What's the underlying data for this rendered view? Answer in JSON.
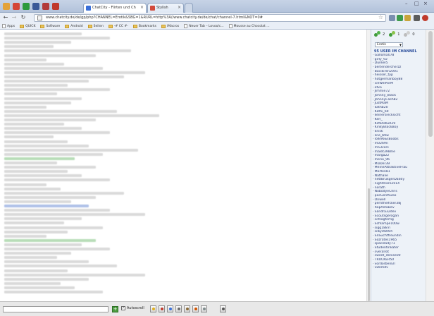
{
  "browser": {
    "tabs": [
      {
        "label": "ChatCity - Flirten und Ch",
        "favicon_color": "#3a6fd8",
        "active": true
      },
      {
        "label": "Stylish",
        "favicon_color": "#d24a3c",
        "active": false
      }
    ],
    "pinned_tab_icons": [
      {
        "name": "bookmark-icon",
        "color": "#e3a23a"
      },
      {
        "name": "gmail-icon",
        "color": "#d44638"
      },
      {
        "name": "messenger-icon",
        "color": "#2b9a3d"
      },
      {
        "name": "facebook-icon",
        "color": "#3b5998"
      },
      {
        "name": "mail-icon",
        "color": "#b23a3a"
      },
      {
        "name": "video-icon",
        "color": "#c0392b"
      }
    ],
    "url": "www.chatcity.de/de/gp/php?CHANNEL=Erotik&SBG=1&RURL=http%3A//www.chatcity.de/de/chat/channel-7.html&NOT=0#",
    "bookmarks": [
      {
        "label": "Apps",
        "type": "page"
      },
      {
        "label": "QUICK",
        "type": "folder"
      },
      {
        "label": "Software",
        "type": "folder"
      },
      {
        "label": "Android",
        "type": "folder"
      },
      {
        "label": "Seiten",
        "type": "folder"
      },
      {
        "label": "-# CC #-",
        "type": "folder"
      },
      {
        "label": "Bookmarks",
        "type": "folder"
      },
      {
        "label": "iMacros",
        "type": "folder"
      },
      {
        "label": "Neuer Tab – Lovoo/c...",
        "type": "page"
      },
      {
        "label": "Mousse au Chocolat ...",
        "type": "page"
      }
    ]
  },
  "sidebar": {
    "stats": [
      {
        "icon": "users-online-icon",
        "value": "2"
      },
      {
        "icon": "users-away-icon",
        "value": "1"
      },
      {
        "icon": "users-other-icon",
        "value": "0"
      }
    ],
    "channel_selected": "Erotik",
    "users_heading": "95 USER IM CHANNEL",
    "users": [
      "Galloma078",
      "girly_92",
      "Dunkel5",
      "bertendercherzz",
      "Bavikiren2001",
      "heisser_typ",
      "hotgermanboy88",
      "ichWillPorM",
      "otvo",
      "Jimmie72",
      "Johnny_Black",
      "JohnnyCash82",
      "JustMaM",
      "kathb20",
      "Kathi_69",
      "keinersiecksicht",
      "Kerl_",
      "KiMidsKuR29",
      "KinkyBlackBoy",
      "knisk",
      "line_b9w",
      "lolk96&sBoobs",
      "m0269n",
      "m53vers",
      "malet398me",
      "marga22",
      "merio_96",
      "Mia0er39",
      "MeineAttraktiveFrau",
      "Morten81",
      "Nathalie",
      "nettBrukgerDaddy",
      "nightmare2014",
      "norath",
      "NobodyeChris",
      "pocGent92oo",
      "Onwell",
      "pernthelfcker38j",
      "RapAstaDev",
      "Sandra32dev",
      "Scoutsgerogan",
      "schlagfertig",
      "Schlampe100w",
      "sigg1887i",
      "silkyst89ch",
      "SnSuchtfreundin",
      "Sozrates1965",
      "spacelady71",
      "Studentinkater",
      "sveralrot",
      "sweet_denise00",
      "TRUCKER50",
      "vordorbenEll",
      "vDemdv"
    ]
  },
  "bottom": {
    "autoscroll_label": "Autoscroll",
    "autoscroll_checked": "✓",
    "send_symbol": "+"
  }
}
